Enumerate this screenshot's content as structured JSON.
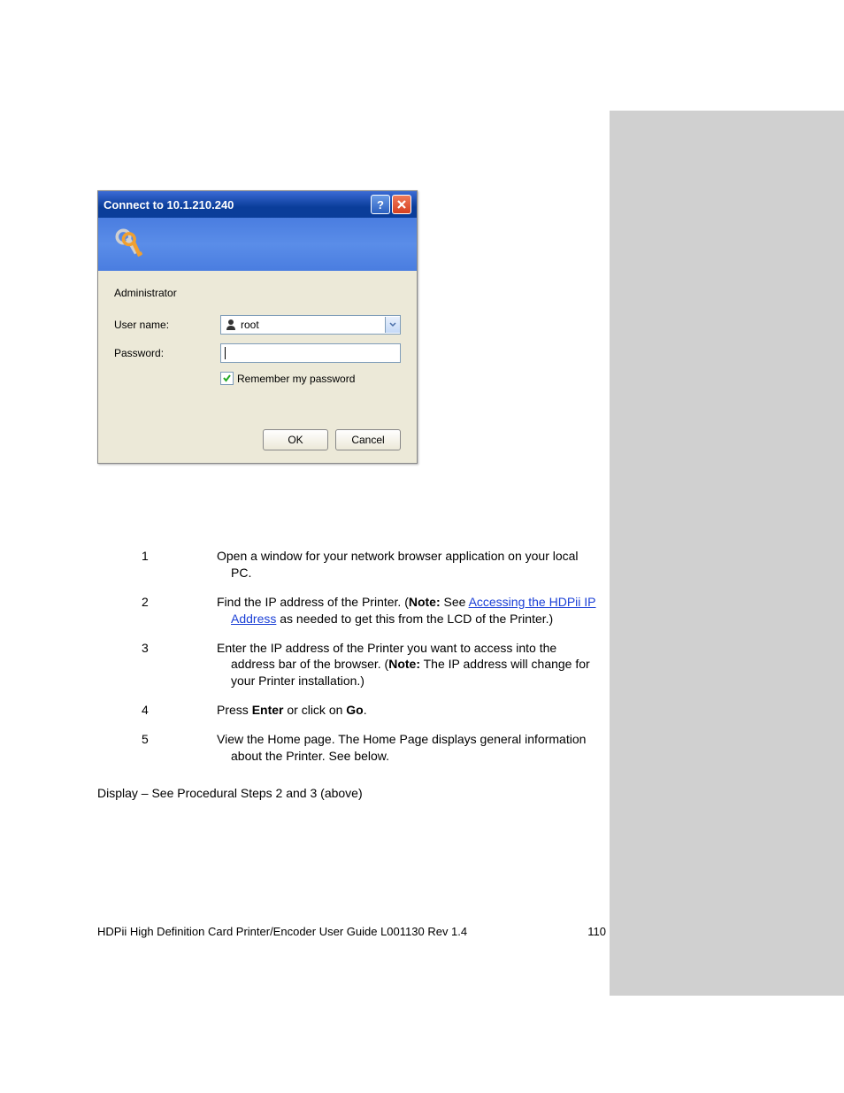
{
  "dialog": {
    "title": "Connect to 10.1.210.240",
    "realm": "Administrator",
    "username_label": "User name:",
    "password_label": "Password:",
    "username_value": "root",
    "remember_label": "Remember my password",
    "ok_label": "OK",
    "cancel_label": "Cancel"
  },
  "steps": [
    {
      "num": "1",
      "text": "Open a window for your network browser application on your local PC."
    },
    {
      "num": "2",
      "prefix": "Find the IP address of the Printer. (",
      "bold": "Note:",
      "mid": " See ",
      "link": "Accessing the HDPii IP Address",
      "suffix": " as needed to get this from the LCD of the Printer.)"
    },
    {
      "num": "3",
      "prefix": "Enter the IP address of the Printer you want to access into the address bar of the browser. (",
      "bold": "Note:",
      "suffix": " The IP address will change for your Printer installation.)"
    },
    {
      "num": "4",
      "prefix": "Press ",
      "bold1": "Enter",
      "mid": " or click on ",
      "bold2": "Go",
      "suffix": "."
    },
    {
      "num": "5",
      "text": "View the Home page. The Home Page displays general information about the Printer. See below."
    }
  ],
  "display_line": "Display – See Procedural Steps 2 and 3 (above)",
  "footer": {
    "left": "HDPii High Definition Card Printer/Encoder User Guide    L001130 Rev 1.4",
    "right": "110"
  }
}
